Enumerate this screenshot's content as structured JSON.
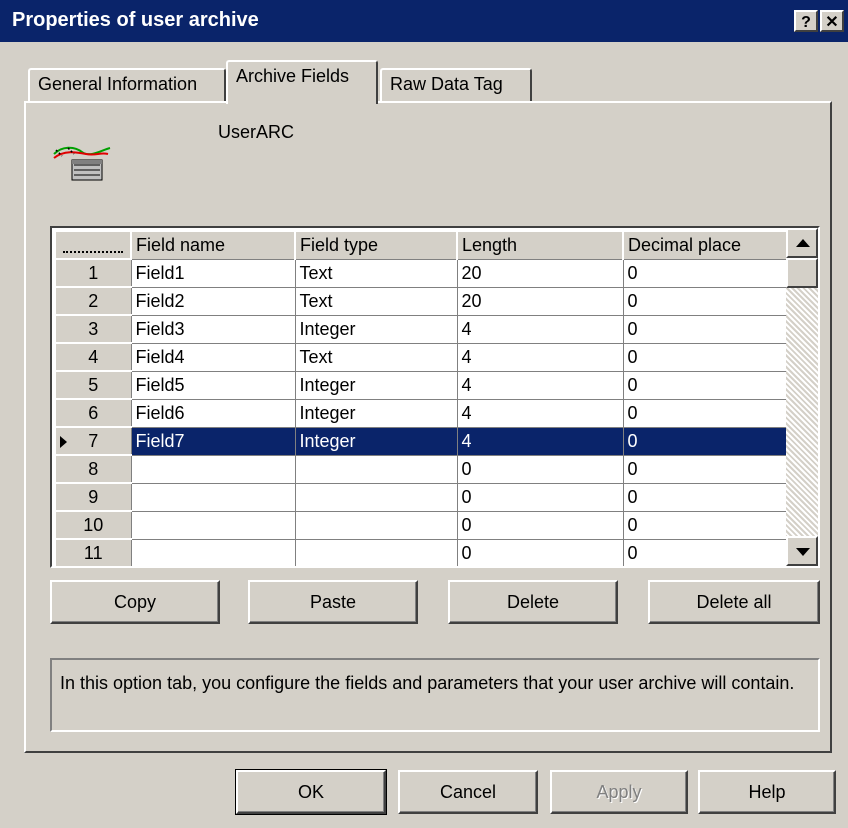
{
  "window": {
    "title": "Properties of user archive",
    "help_label": "?",
    "close_label": "✕"
  },
  "tabs": [
    {
      "label": "General Information",
      "active": false
    },
    {
      "label": "Archive Fields",
      "active": true
    },
    {
      "label": "Raw Data Tag",
      "active": false
    }
  ],
  "archive": {
    "name": "UserARC",
    "icon": "user-archive-icon"
  },
  "grid": {
    "columns": [
      "Field name",
      "Field type",
      "Length",
      "Decimal place"
    ],
    "corner_label": "",
    "selected_row": "7",
    "rows": [
      {
        "num": "1",
        "name": "Field1",
        "type": "Text",
        "length": "20",
        "decimal": "0"
      },
      {
        "num": "2",
        "name": "Field2",
        "type": "Text",
        "length": "20",
        "decimal": "0"
      },
      {
        "num": "3",
        "name": "Field3",
        "type": "Integer",
        "length": "4",
        "decimal": "0"
      },
      {
        "num": "4",
        "name": "Field4",
        "type": "Text",
        "length": "4",
        "decimal": "0"
      },
      {
        "num": "5",
        "name": "Field5",
        "type": "Integer",
        "length": "4",
        "decimal": "0"
      },
      {
        "num": "6",
        "name": "Field6",
        "type": "Integer",
        "length": "4",
        "decimal": "0"
      },
      {
        "num": "7",
        "name": "Field7",
        "type": "Integer",
        "length": "4",
        "decimal": "0"
      },
      {
        "num": "8",
        "name": "",
        "type": "",
        "length": "0",
        "decimal": "0"
      },
      {
        "num": "9",
        "name": "",
        "type": "",
        "length": "0",
        "decimal": "0"
      },
      {
        "num": "10",
        "name": "",
        "type": "",
        "length": "0",
        "decimal": "0"
      },
      {
        "num": "11",
        "name": "",
        "type": "",
        "length": "0",
        "decimal": "0"
      }
    ]
  },
  "edit_buttons": {
    "copy": "Copy",
    "paste": "Paste",
    "delete": "Delete",
    "delete_all": "Delete all"
  },
  "info_text": "In this option tab, you configure the fields and parameters that your user archive will contain.",
  "dialog_buttons": {
    "ok": "OK",
    "cancel": "Cancel",
    "apply": "Apply",
    "help": "Help"
  },
  "colors": {
    "titlebar": "#0a246a",
    "selection": "#0a246a",
    "face": "#d4d0c8"
  }
}
